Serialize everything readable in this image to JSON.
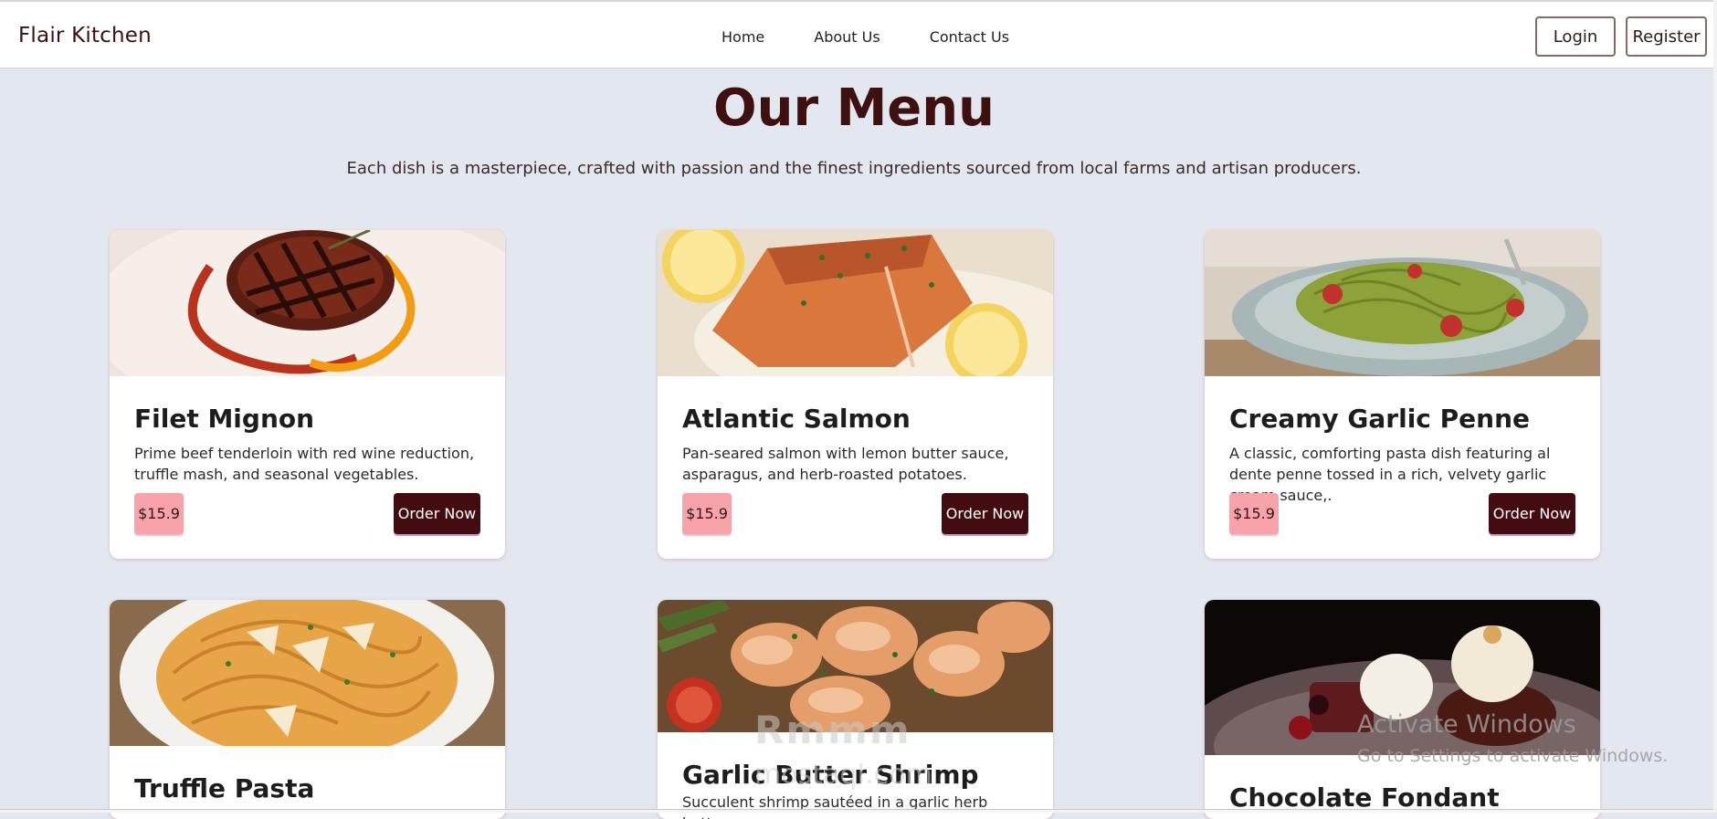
{
  "nav": {
    "brand": "Flair Kitchen",
    "links": [
      "Home",
      "About Us",
      "Contact Us"
    ],
    "login": "Login",
    "register": "Register"
  },
  "hero": {
    "title": "Our Menu",
    "subtitle": "Each dish is a masterpiece, crafted with passion and the finest ingredients sourced from local farms and artisan producers."
  },
  "menu": [
    {
      "title": "Filet Mignon",
      "desc": "Prime beef tenderloin with red wine reduction, truffle mash, and seasonal vegetables.",
      "price": "$15.9",
      "order": "Order Now",
      "image": "steak-image"
    },
    {
      "title": "Atlantic Salmon",
      "desc": "Pan-seared salmon with lemon butter sauce, asparagus, and herb-roasted potatoes.",
      "price": "$15.9",
      "order": "Order Now",
      "image": "salmon-image"
    },
    {
      "title": "Creamy Garlic Penne",
      "desc": "A classic, comforting pasta dish featuring al dente penne tossed in a rich, velvety garlic cream sauce,.",
      "price": "$15.9",
      "order": "Order Now",
      "image": "pesto-pasta-image"
    },
    {
      "title": "Truffle Pasta",
      "desc": "",
      "image": "truffle-pasta-image"
    },
    {
      "title": "Garlic Butter Shrimp",
      "desc": "Succulent shrimp sautéed in a garlic herb butter,",
      "image": "shrimp-image"
    },
    {
      "title": "Chocolate Fondant",
      "desc": "",
      "image": "chocolate-fondant-image"
    }
  ],
  "overlay": {
    "watermark_brand": "Rmmm",
    "watermark_site": "mostaqI.com",
    "activate_title": "Activate Windows",
    "activate_sub": "Go to Settings to activate Windows."
  }
}
